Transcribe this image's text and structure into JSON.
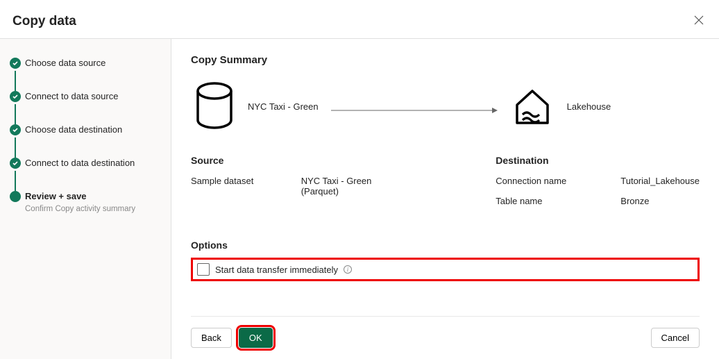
{
  "dialogTitle": "Copy data",
  "steps": [
    {
      "label": "Choose data source",
      "status": "done"
    },
    {
      "label": "Connect to data source",
      "status": "done"
    },
    {
      "label": "Choose data destination",
      "status": "done"
    },
    {
      "label": "Connect to data destination",
      "status": "done"
    },
    {
      "label": "Review + save",
      "sub": "Confirm Copy activity summary",
      "status": "current"
    }
  ],
  "summaryTitle": "Copy Summary",
  "diagram": {
    "sourceLabel": "NYC Taxi - Green",
    "destLabel": "Lakehouse"
  },
  "source": {
    "title": "Source",
    "rows": [
      {
        "label": "Sample dataset",
        "value": "NYC Taxi - Green (Parquet)"
      }
    ]
  },
  "destination": {
    "title": "Destination",
    "rows": [
      {
        "label": "Connection name",
        "value": "Tutorial_Lakehouse"
      },
      {
        "label": "Table name",
        "value": "Bronze"
      }
    ]
  },
  "options": {
    "title": "Options",
    "startImmediately": "Start data transfer immediately"
  },
  "buttons": {
    "back": "Back",
    "ok": "OK",
    "cancel": "Cancel"
  }
}
